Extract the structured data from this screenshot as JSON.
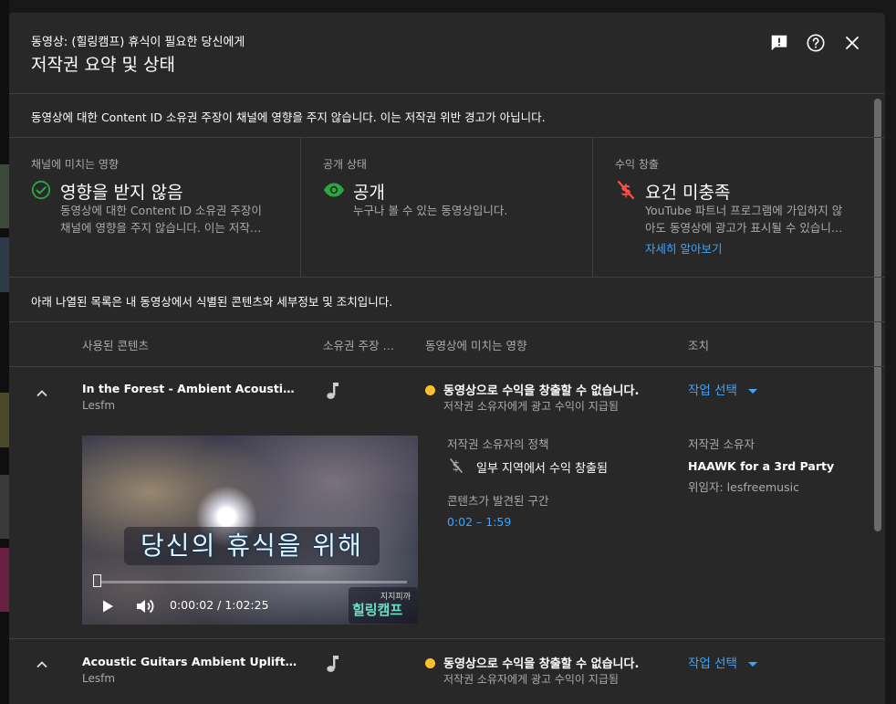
{
  "header": {
    "subtitle": "동영상: (힐링캠프) 휴식이 필요한 당신에게",
    "title": "저작권 요약 및 상태",
    "icons": [
      "feedback-icon",
      "help-icon",
      "close-icon"
    ]
  },
  "notice": "동영상에 대한 Content ID 소유권 주장이 채널에 영향을 주지 않습니다. 이는 저작권 위반 경고가 아닙니다.",
  "cards": {
    "impact": {
      "label": "채널에 미치는 영향",
      "title": "영향을 받지 않음",
      "desc_line1": "동영상에 대한 Content ID 소유권 주장이",
      "desc_line2": "채널에 영향을 주지 않습니다. 이는 저작…"
    },
    "visibility": {
      "label": "공개 상태",
      "title": "공개",
      "desc": "누구나 볼 수 있는 동영상입니다."
    },
    "monetization": {
      "label": "수익 창출",
      "title": "요건 미충족",
      "desc_line1": "YouTube 파트너 프로그램에 가입하지 않",
      "desc_line2": "아도 동영상에 광고가 표시될 수 있습니…",
      "link": "자세히 알아보기"
    }
  },
  "intro": "아래 나열된 목록은 내 동영상에서 식별된 콘텐츠와 세부정보 및 조치입니다.",
  "columns": {
    "content": "사용된 콘텐츠",
    "claim": "소유권 주장 …",
    "impact": "동영상에 미치는 영향",
    "action": "조치"
  },
  "rows": [
    {
      "title": "In the Forest - Ambient Acoustic Guitar…",
      "artist": "Lesfm",
      "impact_main": "동영상으로 수익을 창출할 수 없습니다.",
      "impact_sub": "저작권 소유자에게 광고 수익이 지급됨",
      "action": "작업 선택"
    },
    {
      "title": "Acoustic Guitars Ambient Uplifting",
      "artist": "Lesfm",
      "impact_main": "동영상으로 수익을 창출할 수 없습니다.",
      "impact_sub": "저작권 소유자에게 광고 수익이 지급됨",
      "action": "작업 선택"
    }
  ],
  "details": {
    "policy_label": "저작권 소유자의 정책",
    "policy_text": "일부 지역에서 수익 창출됨",
    "segment_label": "콘텐츠가 발견된 구간",
    "segment": "0:02 – 1:59",
    "owner_label": "저작권 소유자",
    "owner": "HAAWK for a 3rd Party",
    "delegate": "위임자: lesfreemusic"
  },
  "video": {
    "caption": "당신의 휴식을 위해",
    "time": "0:00:02 / 1:02:25",
    "progress": 0.0005,
    "logo_top": "지지피까",
    "logo_main": "힐링캠프"
  },
  "colors": {
    "accent": "#3ea6ff",
    "success": "#2ba640",
    "error": "#ff4e45",
    "warning": "#fbc02d",
    "dialog_bg": "#282828"
  }
}
